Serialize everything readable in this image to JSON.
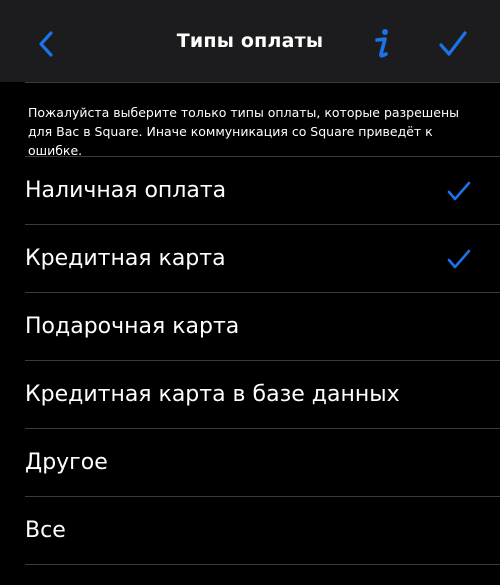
{
  "nav": {
    "title": "Типы оплаты",
    "back_icon": "chevron-left-icon",
    "info_icon": "info-icon",
    "done_icon": "checkmark-icon"
  },
  "hint": "Пожалуйста выберите только типы оплаты, которые разрешены для Вас в Square. Иначе коммуникация со Square приведёт к ошибке.",
  "options": [
    {
      "label": "Наличная оплата",
      "checked": true
    },
    {
      "label": "Кредитная карта",
      "checked": true
    },
    {
      "label": "Подарочная карта",
      "checked": false
    },
    {
      "label": "Кредитная карта в базе данных",
      "checked": false
    },
    {
      "label": "Другое",
      "checked": false
    },
    {
      "label": "Все",
      "checked": false
    }
  ],
  "colors": {
    "accent": "#1a73e8",
    "background": "#000000",
    "navbar": "#1c1c1e",
    "separator": "#3a3a3c"
  }
}
